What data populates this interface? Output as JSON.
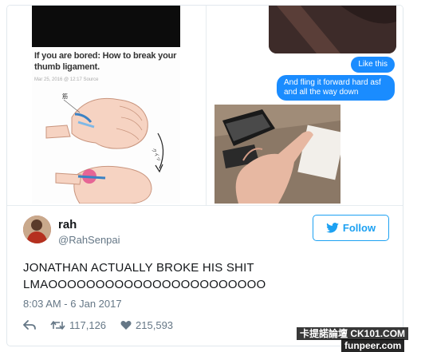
{
  "media": {
    "article_title": "If you are bored: How to break your thumb ligament.",
    "article_meta": "Mar 25, 2016 @ 12:17  Source",
    "diagram_label": "筋",
    "diagram_sound": "クイッ",
    "bubbles": [
      "Like this",
      "And fling it forward hard asf and all the way down"
    ]
  },
  "author": {
    "name": "rah",
    "handle": "@RahSenpai"
  },
  "follow_label": "Follow",
  "tweet": {
    "lines": [
      "JONATHAN ACTUALLY BROKE HIS SHIT",
      "LMAOOOOOOOOOOOOOOOOOOOOOOO"
    ],
    "timestamp": "8:03 AM - 6 Jan 2017"
  },
  "actions": {
    "retweets": "117,126",
    "likes": "215,593"
  },
  "watermarks": [
    "卡提諾論壇 CK101.COM",
    "funpeer.com"
  ],
  "colors": {
    "twitter_blue": "#1da1f2",
    "imessage_blue": "#1a8cff",
    "text": "#14171a",
    "muted": "#657786"
  }
}
